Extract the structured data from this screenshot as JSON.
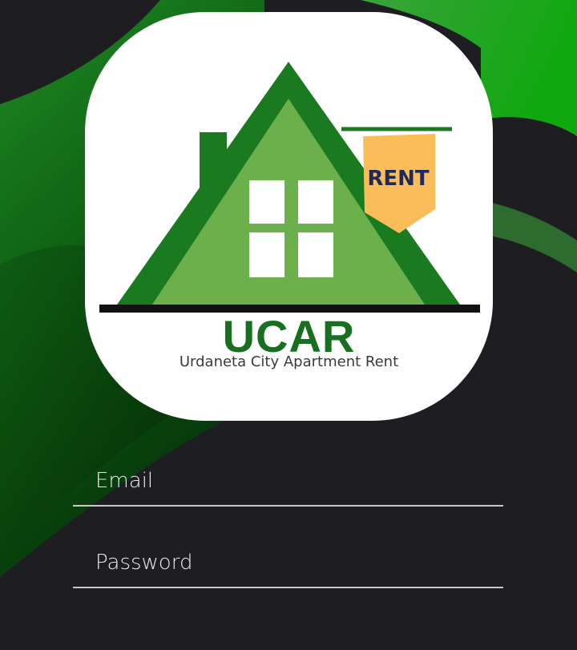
{
  "logo": {
    "sign_text": "RENT",
    "title": "UCAR",
    "subtitle": "Urdaneta City Apartment Rent"
  },
  "login_form": {
    "email_placeholder": "Email",
    "email_value": "",
    "password_placeholder": "Password",
    "password_value": ""
  },
  "colors": {
    "background": "#1e1d21",
    "brand_green": "#16701f",
    "roof_green": "#1a7a1f",
    "house_light_green": "#6bb04a",
    "sign_orange": "#fbbd5a",
    "field_underline": "#c9c9c9"
  }
}
